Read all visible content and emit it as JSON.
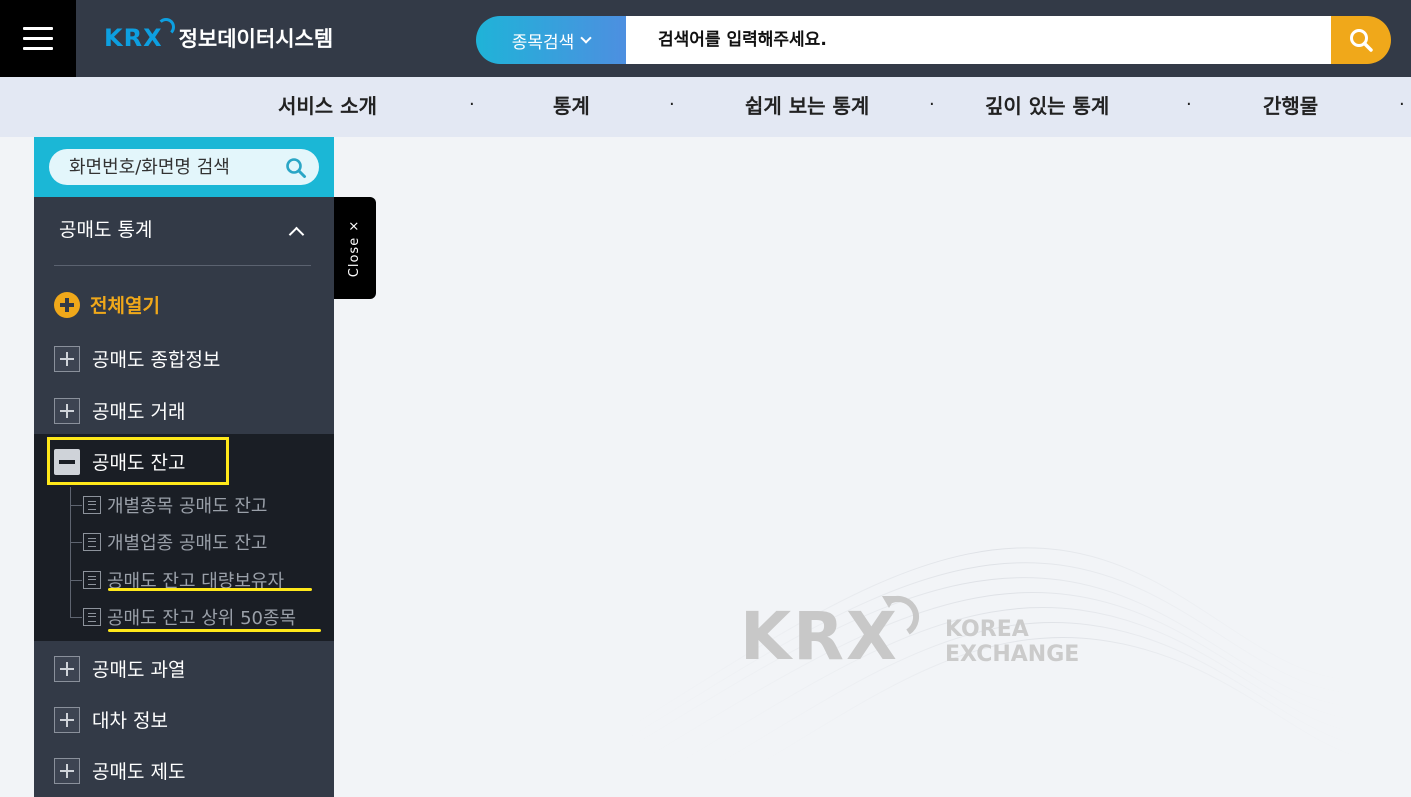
{
  "header": {
    "logo_text": "KRX",
    "title": "정보데이터시스템",
    "search_type": "종목검색",
    "search_placeholder": "검색어를 입력해주세요."
  },
  "nav": {
    "items": [
      "서비스 소개",
      "통계",
      "쉽게 보는 통계",
      "깊이 있는 통계",
      "간행물"
    ],
    "separator": "·"
  },
  "sidebar": {
    "search_placeholder": "화면번호/화면명 검색",
    "section_title": "공매도 통계",
    "open_all_label": "전체열기",
    "items": [
      {
        "label": "공매도 종합정보"
      },
      {
        "label": "공매도 거래"
      },
      {
        "label": "공매도 잔고"
      },
      {
        "label": "공매도 과열"
      },
      {
        "label": "대차 정보"
      },
      {
        "label": "공매도 제도"
      }
    ],
    "sub_items": [
      {
        "label": "개별종목 공매도 잔고"
      },
      {
        "label": "개별업종 공매도 잔고"
      },
      {
        "label": "공매도 잔고 대량보유자"
      },
      {
        "label": "공매도 잔고 상위 50종목"
      }
    ]
  },
  "close_tab_label": "Close ×",
  "watermark": {
    "krx": "KRX",
    "line1": "KOREA",
    "line2": "EXCHANGE"
  },
  "colors": {
    "header_bg": "#333a47",
    "accent_cyan": "#1bb7d6",
    "accent_orange": "#f0a81a",
    "highlight_yellow": "#ffe81a",
    "nav_bg": "#e3e8f3"
  }
}
